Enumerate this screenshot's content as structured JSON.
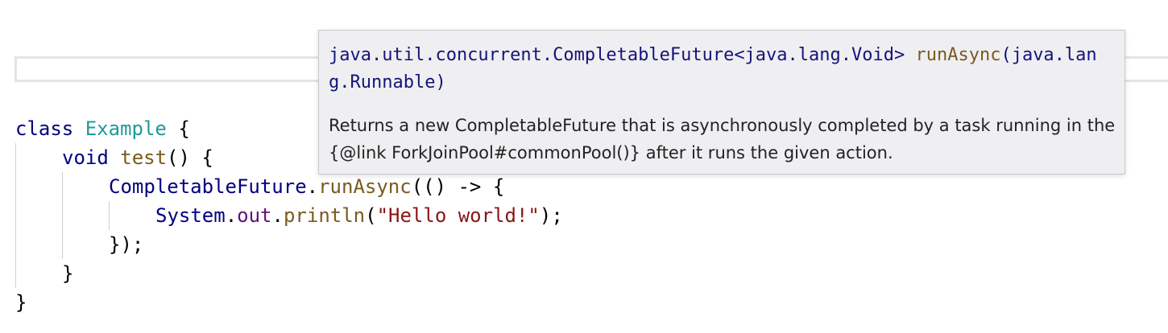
{
  "code": {
    "line1": {
      "keyword": "class",
      "class_name": "Example",
      "brace": "{"
    },
    "line2": {
      "type": "void",
      "method": "test",
      "rest": "() {"
    },
    "line3": {
      "class_ref": "CompletableFuture",
      "dot": ".",
      "method": "runAsync",
      "rest": "(() -> {"
    },
    "line4": {
      "class_ref": "System",
      "dot1": ".",
      "field": "out",
      "dot2": ".",
      "method": "println",
      "open": "(",
      "string": "\"Hello world!\"",
      "close": ");"
    },
    "line5": {
      "text": "});"
    },
    "line6": {
      "text": "}"
    },
    "line7": {
      "text": "}"
    }
  },
  "tooltip": {
    "signature_prefix": "java.util.concurrent.CompletableFuture<java.lang.Void> ",
    "signature_method": "runAsync",
    "signature_suffix": "(java.lang.Runnable)",
    "description": "Returns a new CompletableFuture that is asynchronously completed by a task running in the {@link ForkJoinPool#commonPool()} after it runs the given action."
  },
  "colors": {
    "keyword": "#000080",
    "class_name": "#20999d",
    "method": "#7a5a1e",
    "field": "#660e7a",
    "string": "#8a1414",
    "tooltip_bg": "#efeff2"
  }
}
